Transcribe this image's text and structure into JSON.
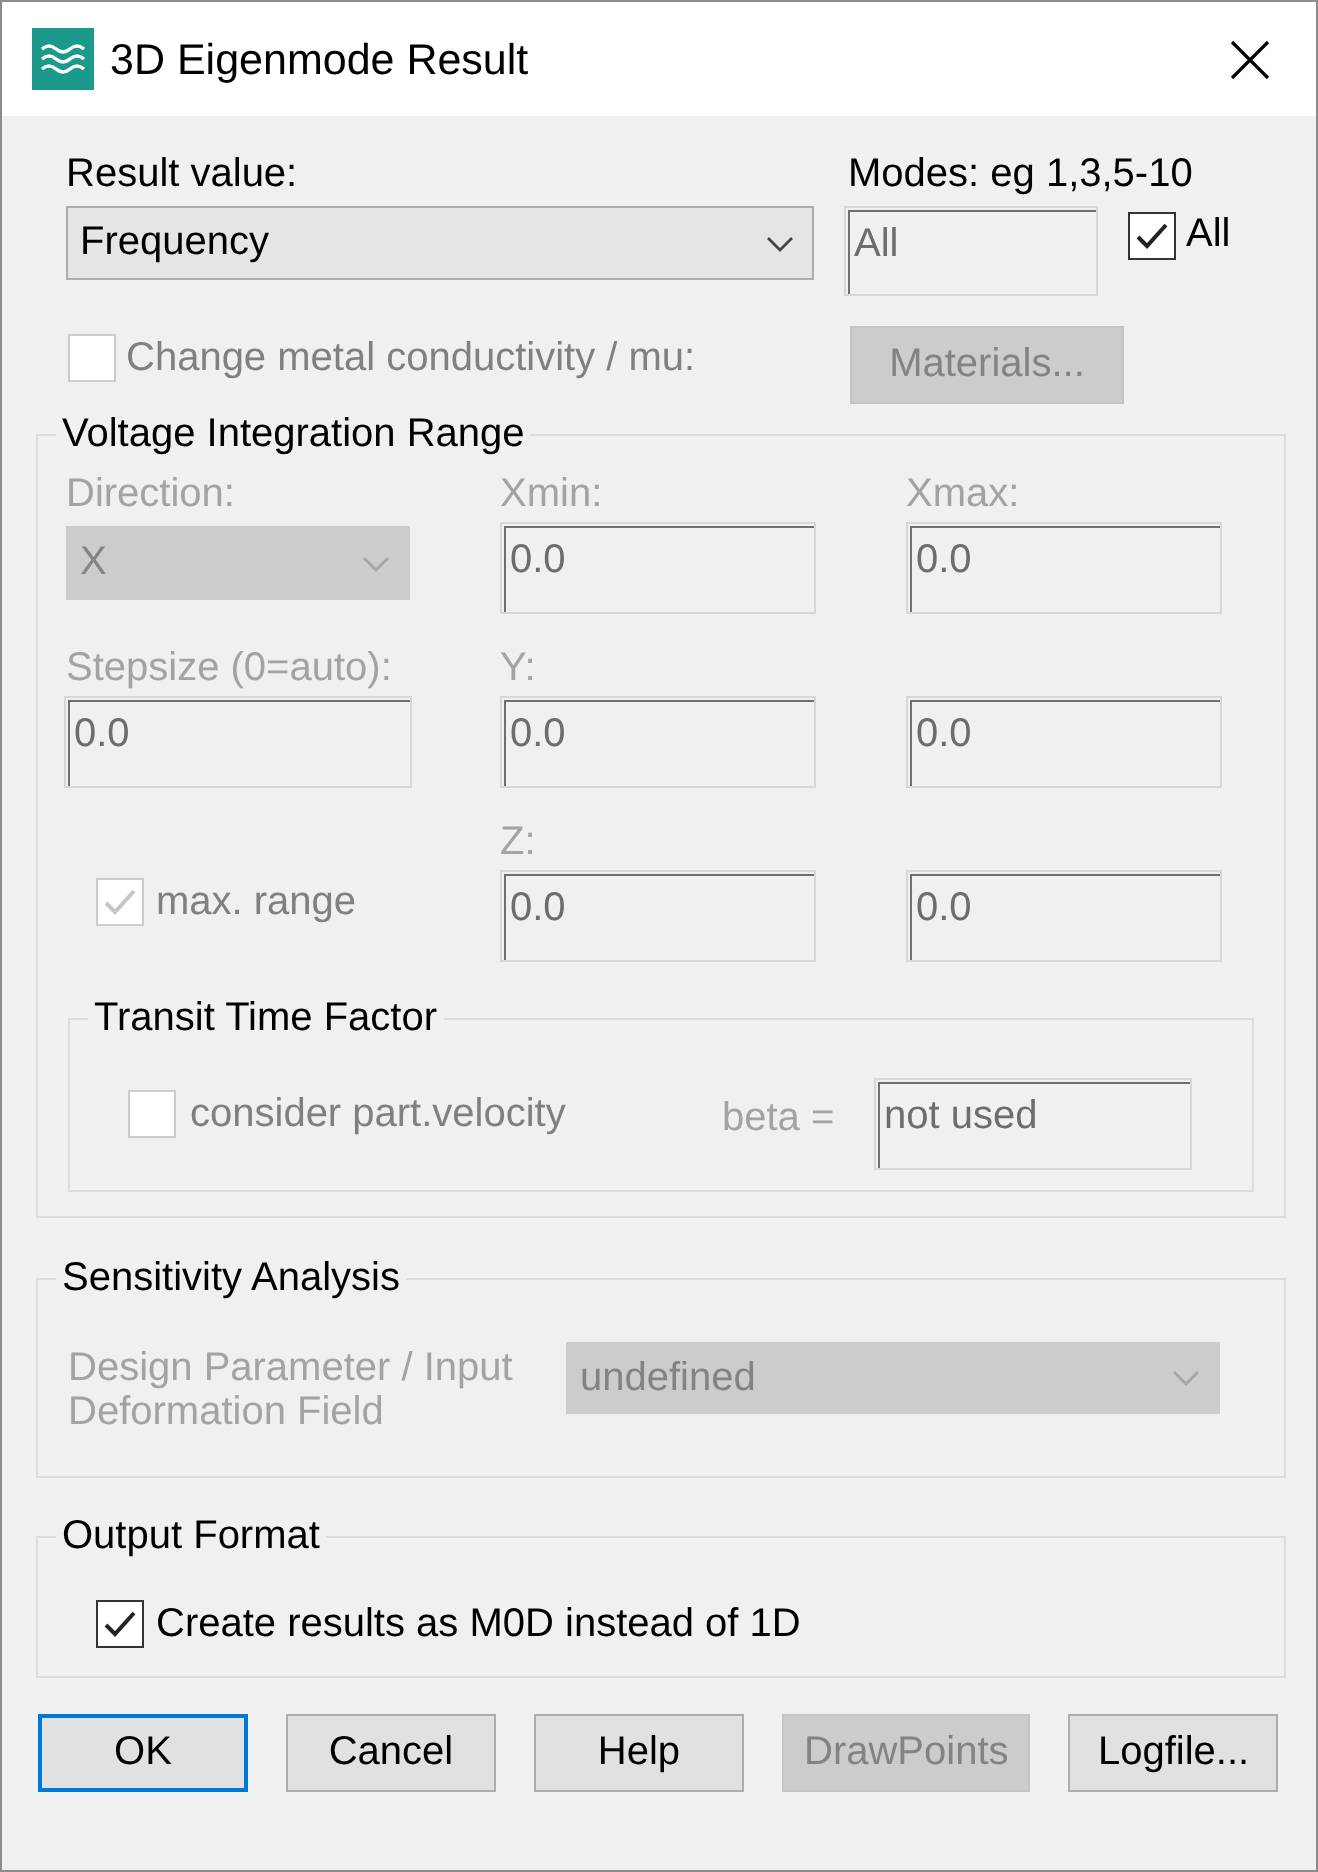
{
  "window": {
    "title": "3D Eigenmode Result"
  },
  "result_value": {
    "label": "Result value:",
    "value": "Frequency",
    "disabled": false
  },
  "modes": {
    "label": "Modes: eg 1,3,5-10",
    "value": "All",
    "disabled": true,
    "all_checkbox": {
      "label": "All",
      "checked": true,
      "disabled": false
    }
  },
  "metal_conductivity": {
    "label": "Change metal conductivity / mu:",
    "checked": false,
    "disabled": true
  },
  "materials_button": {
    "label": "Materials...",
    "disabled": true
  },
  "voltage_integration_range": {
    "title": "Voltage Integration Range",
    "rows": [
      {
        "cells": [
          {
            "kind": "combo",
            "label": "Direction:",
            "value": "X",
            "disabled": true
          },
          {
            "kind": "field",
            "label": "Xmin:",
            "value": "0.0",
            "disabled": true
          },
          {
            "kind": "field",
            "label": "Xmax:",
            "value": "0.0",
            "disabled": true
          }
        ]
      },
      {
        "cells": [
          {
            "kind": "field",
            "label": "Stepsize (0=auto):",
            "value": "0.0",
            "disabled": true
          },
          {
            "kind": "field",
            "label": "Y:",
            "value": "0.0",
            "disabled": true
          },
          {
            "kind": "field",
            "value": "0.0",
            "disabled": true
          }
        ]
      },
      {
        "cells": [
          {
            "kind": "checkbox",
            "label": "max. range",
            "checked": true,
            "disabled": true
          },
          {
            "kind": "field",
            "label": "Z:",
            "value": "0.0",
            "disabled": true
          },
          {
            "kind": "field",
            "value": "0.0",
            "disabled": true
          }
        ]
      }
    ],
    "transit_time_factor": {
      "title": "Transit Time Factor",
      "velocity": {
        "label": "consider part.velocity",
        "checked": false,
        "disabled": true
      },
      "beta": {
        "label": "beta =",
        "value": "not used",
        "disabled": true
      }
    }
  },
  "sensitivity_analysis": {
    "title": "Sensitivity Analysis",
    "label": "Design Parameter / Input\nDeformation Field",
    "value": "undefined",
    "disabled": true
  },
  "output_format": {
    "title": "Output Format",
    "checkbox": {
      "label": "Create results as M0D instead of 1D",
      "checked": true,
      "disabled": false
    }
  },
  "buttons": [
    {
      "label": "OK",
      "default": true,
      "disabled": false
    },
    {
      "label": "Cancel",
      "default": false,
      "disabled": false
    },
    {
      "label": "Help",
      "default": false,
      "disabled": false
    },
    {
      "label": "DrawPoints",
      "default": false,
      "disabled": true
    },
    {
      "label": "Logfile...",
      "default": false,
      "disabled": false
    }
  ]
}
